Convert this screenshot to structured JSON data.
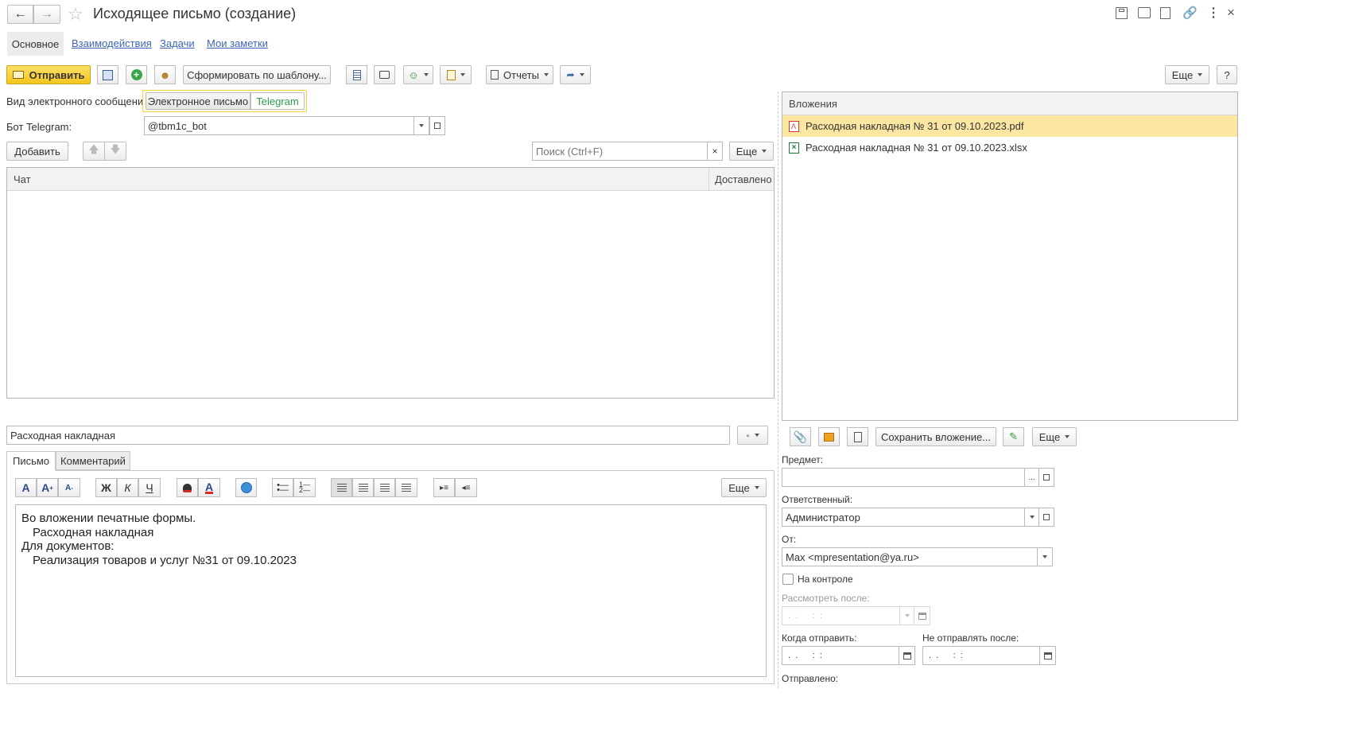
{
  "window": {
    "title": "Исходящее письмо (создание)"
  },
  "nav_tabs": [
    {
      "label": "Основное"
    },
    {
      "label": "Взаимодействия"
    },
    {
      "label": "Задачи"
    },
    {
      "label": "Мои заметки"
    }
  ],
  "toolbar": {
    "send_label": "Отправить",
    "template_label": "Сформировать по шаблону...",
    "reports_label": "Отчеты",
    "more_label": "Еще",
    "help_label": "?"
  },
  "message_type": {
    "label": "Вид электронного сообщения:",
    "options": [
      "Электронное письмо",
      "Telegram"
    ],
    "selected": "Telegram"
  },
  "bot": {
    "label": "Бот Telegram:",
    "value": "@tbm1c_bot"
  },
  "recipients": {
    "add_label": "Добавить",
    "search_placeholder": "Поиск (Ctrl+F)",
    "search_clear": "×",
    "more_label": "Еще",
    "columns": [
      "Чат",
      "Доставлено"
    ],
    "rows": []
  },
  "subject": {
    "value": "Расходная накладная",
    "importance_glyph": "•"
  },
  "body_tabs": [
    {
      "label": "Письмо"
    },
    {
      "label": "Комментарий"
    }
  ],
  "editor": {
    "more_label": "Еще",
    "format": {
      "bold": "Ж",
      "italic": "К",
      "underline": "Ч",
      "font": "A"
    },
    "lines": [
      "Во вложении печатные формы.",
      "Расходная накладная",
      "Для документов:",
      "Реализация товаров и услуг №31 от 09.10.2023"
    ]
  },
  "attachments": {
    "header": "Вложения",
    "items": [
      {
        "name": "Расходная накладная № 31 от 09.10.2023.pdf",
        "type": "pdf",
        "selected": true
      },
      {
        "name": "Расходная накладная № 31 от 09.10.2023.xlsx",
        "type": "xlsx",
        "selected": false
      }
    ],
    "save_label": "Сохранить вложение...",
    "more_label": "Еще"
  },
  "props": {
    "subject_label": "Предмет:",
    "subject_value": "",
    "responsible_label": "Ответственный:",
    "responsible_value": "Администратор",
    "from_label": "От:",
    "from_value": "Max <mpresentation@ya.ru>",
    "on_control_label": "На контроле",
    "review_after_label": "Рассмотреть после:",
    "date_mask": " .  .      :  :",
    "send_when_label": "Когда отправить:",
    "dont_send_after_label": "Не отправлять после:",
    "sent_label": "Отправлено:"
  },
  "colors": {
    "send_button": "#f7d12e",
    "selected_row": "#fbe7a1",
    "link": "#3c66b7",
    "telegram_green": "#2a9d4b"
  }
}
